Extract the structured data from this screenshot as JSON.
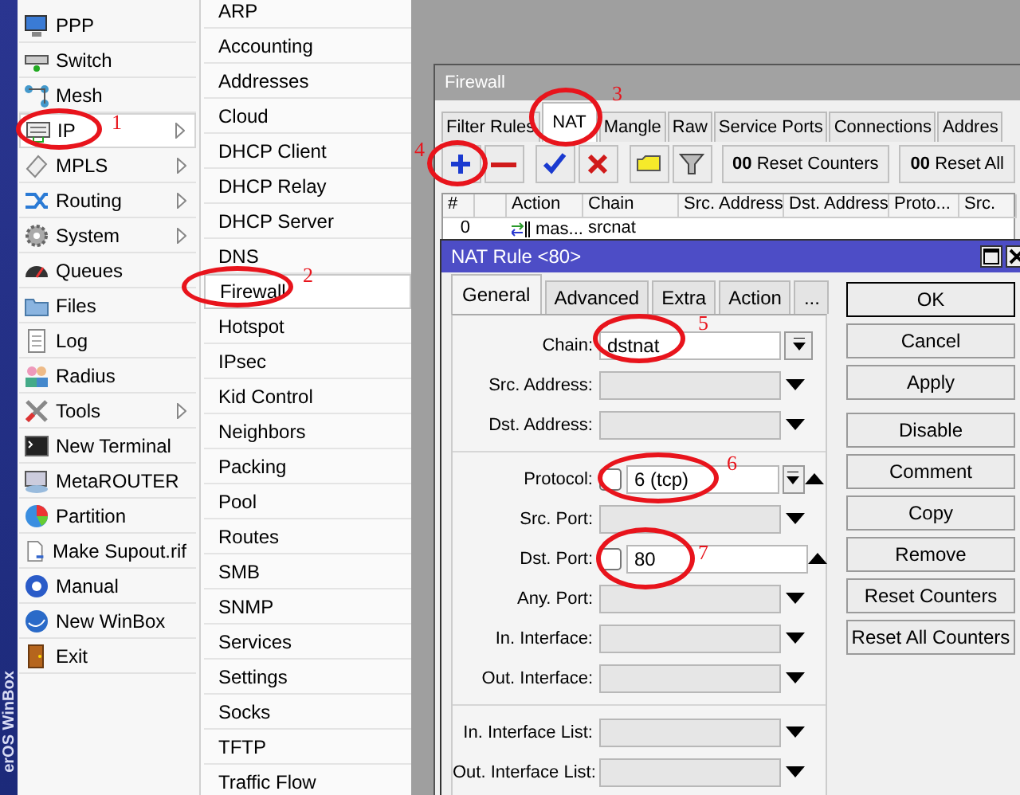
{
  "sidebar": {
    "brand": "erOS WinBox",
    "items": [
      {
        "label": "PPP",
        "selected": false,
        "submenu": false
      },
      {
        "label": "Switch",
        "selected": false,
        "submenu": false
      },
      {
        "label": "Mesh",
        "selected": false,
        "submenu": false
      },
      {
        "label": "IP",
        "selected": true,
        "submenu": true
      },
      {
        "label": "MPLS",
        "selected": false,
        "submenu": true
      },
      {
        "label": "Routing",
        "selected": false,
        "submenu": true
      },
      {
        "label": "System",
        "selected": false,
        "submenu": true
      },
      {
        "label": "Queues",
        "selected": false,
        "submenu": false
      },
      {
        "label": "Files",
        "selected": false,
        "submenu": false
      },
      {
        "label": "Log",
        "selected": false,
        "submenu": false
      },
      {
        "label": "Radius",
        "selected": false,
        "submenu": false
      },
      {
        "label": "Tools",
        "selected": false,
        "submenu": true
      },
      {
        "label": "New Terminal",
        "selected": false,
        "submenu": false
      },
      {
        "label": "MetaROUTER",
        "selected": false,
        "submenu": false
      },
      {
        "label": "Partition",
        "selected": false,
        "submenu": false
      },
      {
        "label": "Make Supout.rif",
        "selected": false,
        "submenu": false
      },
      {
        "label": "Manual",
        "selected": false,
        "submenu": false
      },
      {
        "label": "New WinBox",
        "selected": false,
        "submenu": false
      },
      {
        "label": "Exit",
        "selected": false,
        "submenu": false
      }
    ]
  },
  "submenu": {
    "items": [
      {
        "label": "ARP",
        "selected": false
      },
      {
        "label": "Accounting",
        "selected": false
      },
      {
        "label": "Addresses",
        "selected": false
      },
      {
        "label": "Cloud",
        "selected": false
      },
      {
        "label": "DHCP Client",
        "selected": false
      },
      {
        "label": "DHCP Relay",
        "selected": false
      },
      {
        "label": "DHCP Server",
        "selected": false
      },
      {
        "label": "DNS",
        "selected": false
      },
      {
        "label": "Firewall",
        "selected": true
      },
      {
        "label": "Hotspot",
        "selected": false
      },
      {
        "label": "IPsec",
        "selected": false
      },
      {
        "label": "Kid Control",
        "selected": false
      },
      {
        "label": "Neighbors",
        "selected": false
      },
      {
        "label": "Packing",
        "selected": false
      },
      {
        "label": "Pool",
        "selected": false
      },
      {
        "label": "Routes",
        "selected": false
      },
      {
        "label": "SMB",
        "selected": false
      },
      {
        "label": "SNMP",
        "selected": false
      },
      {
        "label": "Services",
        "selected": false
      },
      {
        "label": "Settings",
        "selected": false
      },
      {
        "label": "Socks",
        "selected": false
      },
      {
        "label": "TFTP",
        "selected": false
      },
      {
        "label": "Traffic Flow",
        "selected": false
      }
    ]
  },
  "firewall": {
    "title": "Firewall",
    "tabs": [
      {
        "label": "Filter Rules",
        "selected": false
      },
      {
        "label": "NAT",
        "selected": true
      },
      {
        "label": "Mangle",
        "selected": false
      },
      {
        "label": "Raw",
        "selected": false
      },
      {
        "label": "Service Ports",
        "selected": false
      },
      {
        "label": "Connections",
        "selected": false
      },
      {
        "label": "Addres",
        "selected": false
      }
    ],
    "toolbar": [
      {
        "kind": "add"
      },
      {
        "kind": "remove"
      },
      {
        "kind": "enable"
      },
      {
        "kind": "disable"
      },
      {
        "kind": "comment"
      },
      {
        "kind": "filter"
      },
      {
        "kind": "text",
        "prefix": "00",
        "label": "Reset Counters"
      },
      {
        "kind": "text",
        "prefix": "00",
        "label": "Reset All"
      }
    ],
    "table": {
      "columns": [
        {
          "label": "#"
        },
        {},
        {
          "label": "Action"
        },
        {
          "label": "Chain"
        },
        {
          "label": "Src. Address"
        },
        {
          "label": "Dst. Address"
        },
        {
          "label": "Proto..."
        },
        {
          "label": "Src."
        }
      ],
      "rows": [
        {
          "number": "0",
          "action": "mas...",
          "chain": "srcnat"
        }
      ]
    }
  },
  "nat_rule": {
    "title": "NAT Rule <80>",
    "tabs": [
      {
        "label": "General",
        "selected": true
      },
      {
        "label": "Advanced",
        "selected": false
      },
      {
        "label": "Extra",
        "selected": false
      },
      {
        "label": "Action",
        "selected": false
      },
      {
        "label": "...",
        "selected": false
      }
    ],
    "sections": [
      {
        "fields": [
          {
            "kind": "select",
            "label": "Chain:",
            "value": "dstnat"
          },
          {
            "kind": "filter",
            "label": "Src. Address:",
            "expanded": false
          },
          {
            "kind": "filter",
            "label": "Dst. Address:",
            "expanded": false
          }
        ]
      },
      {
        "fields": [
          {
            "kind": "negatable",
            "label": "Protocol:",
            "value": "6 (tcp)",
            "negated": false,
            "dropdown": true,
            "expanded": true
          },
          {
            "kind": "filter",
            "label": "Src. Port:",
            "expanded": false
          },
          {
            "kind": "negatable",
            "label": "Dst. Port:",
            "value": "80",
            "negated": false,
            "dropdown": false,
            "expanded": true
          },
          {
            "kind": "filter",
            "label": "Any. Port:",
            "expanded": false
          },
          {
            "kind": "filter",
            "label": "In. Interface:",
            "expanded": false
          },
          {
            "kind": "filter",
            "label": "Out. Interface:",
            "expanded": false
          }
        ]
      },
      {
        "fields": [
          {
            "kind": "filter",
            "label": "In. Interface List:",
            "expanded": false
          },
          {
            "kind": "filter",
            "label": "Out. Interface List:",
            "expanded": false
          }
        ]
      }
    ],
    "button_groups": [
      [
        {
          "label": "OK",
          "default": true
        },
        {
          "label": "Cancel",
          "default": false
        },
        {
          "label": "Apply",
          "default": false
        }
      ],
      [
        {
          "label": "Disable",
          "default": false
        },
        {
          "label": "Comment",
          "default": false
        },
        {
          "label": "Copy",
          "default": false
        },
        {
          "label": "Remove",
          "default": false
        },
        {
          "label": "Reset Counters",
          "default": false
        },
        {
          "label": "Reset All Counters",
          "default": false
        }
      ]
    ]
  },
  "annotations": [
    {
      "label": "1"
    },
    {
      "label": "2"
    },
    {
      "label": "3"
    },
    {
      "label": "4"
    },
    {
      "label": "5"
    },
    {
      "label": "6"
    },
    {
      "label": "7"
    }
  ]
}
